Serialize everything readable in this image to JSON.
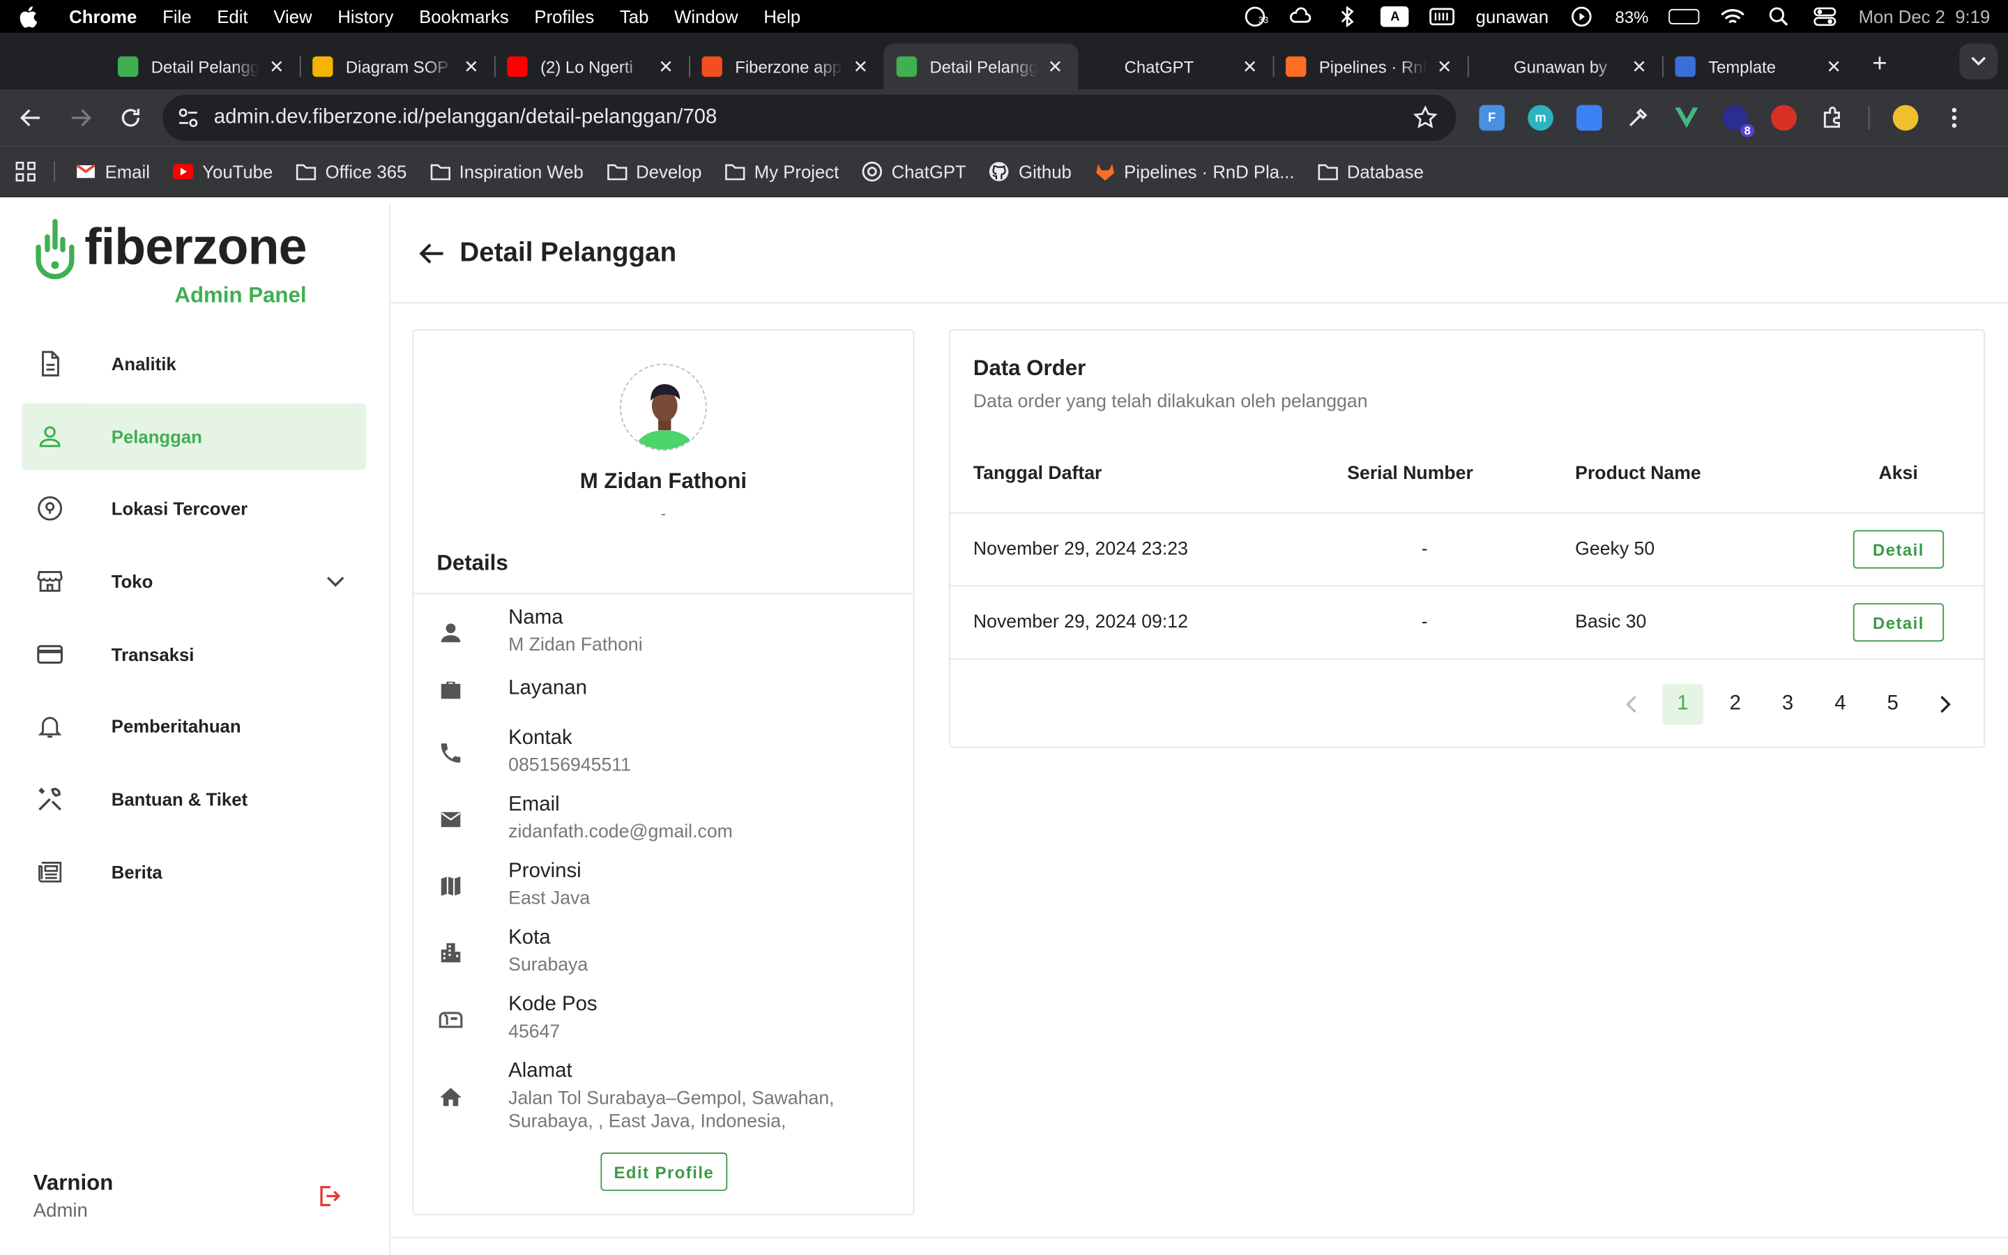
{
  "menubar": {
    "app": "Chrome",
    "items": [
      "File",
      "Edit",
      "View",
      "History",
      "Bookmarks",
      "Profiles",
      "Tab",
      "Window",
      "Help"
    ],
    "notif_count": "33",
    "a_box": "A",
    "username": "gunawan",
    "battery": "83%",
    "battery_level": 0.83,
    "datetime": "Mon Dec 2  9:19"
  },
  "tabs": [
    {
      "title": "Detail Pelanggan",
      "favicon_color": "#3faf51",
      "active": false
    },
    {
      "title": "Diagram SOP",
      "favicon_color": "#f4b400",
      "active": false
    },
    {
      "title": "(2) Lo Ngerti",
      "favicon_color": "#ff0000",
      "active": false
    },
    {
      "title": "Fiberzone app",
      "favicon_color": "#f24e1e",
      "active": false
    },
    {
      "title": "Detail Pelanggan",
      "favicon_color": "#3faf51",
      "active": true
    },
    {
      "title": "ChatGPT",
      "favicon_color": "#202124",
      "active": false
    },
    {
      "title": "Pipelines · RnD",
      "favicon_color": "#fc6d26",
      "active": false
    },
    {
      "title": "Gunawan by",
      "favicon_color": "#202124",
      "active": false
    },
    {
      "title": "Template",
      "favicon_color": "#3b6fd8",
      "active": false
    }
  ],
  "toolbar": {
    "url": "admin.dev.fiberzone.id/pelanggan/detail-pelanggan/708",
    "ext_badge": "8"
  },
  "bookmarks": [
    {
      "label": "Email",
      "icon": "gmail-icon"
    },
    {
      "label": "YouTube",
      "icon": "youtube-icon"
    },
    {
      "label": "Office 365",
      "icon": "folder-icon"
    },
    {
      "label": "Inspiration Web",
      "icon": "folder-icon"
    },
    {
      "label": "Develop",
      "icon": "folder-icon"
    },
    {
      "label": "My Project",
      "icon": "folder-icon"
    },
    {
      "label": "ChatGPT",
      "icon": "chatgpt-icon"
    },
    {
      "label": "Github",
      "icon": "github-icon"
    },
    {
      "label": "Pipelines · RnD Pla...",
      "icon": "gitlab-icon"
    },
    {
      "label": "Database",
      "icon": "folder-icon"
    }
  ],
  "brand": {
    "name": "fiberzone",
    "subtitle": "Admin Panel",
    "accent": "#3faf51"
  },
  "sidebar": {
    "items": [
      {
        "label": "Analitik",
        "icon": "document-icon"
      },
      {
        "label": "Pelanggan",
        "icon": "person-icon",
        "active": true
      },
      {
        "label": "Lokasi Tercover",
        "icon": "location-pin-icon"
      },
      {
        "label": "Toko",
        "icon": "store-icon",
        "expandable": true
      },
      {
        "label": "Transaksi",
        "icon": "credit-card-icon"
      },
      {
        "label": "Pemberitahuan",
        "icon": "bell-icon"
      },
      {
        "label": "Bantuan & Tiket",
        "icon": "tools-icon"
      },
      {
        "label": "Berita",
        "icon": "newspaper-icon"
      }
    ],
    "user": {
      "name": "Varnion",
      "role": "Admin"
    }
  },
  "page": {
    "title": "Detail Pelanggan"
  },
  "profile": {
    "name": "M Zidan Fathoni",
    "subtitle": "-",
    "details_title": "Details",
    "fields": [
      {
        "label": "Nama",
        "value": "M Zidan Fathoni",
        "icon": "person-icon"
      },
      {
        "label": "Layanan",
        "value": "",
        "icon": "briefcase-icon"
      },
      {
        "label": "Kontak",
        "value": "085156945511",
        "icon": "phone-icon"
      },
      {
        "label": "Email",
        "value": "zidanfath.code@gmail.com",
        "icon": "mail-icon"
      },
      {
        "label": "Provinsi",
        "value": "East Java",
        "icon": "map-icon"
      },
      {
        "label": "Kota",
        "value": "Surabaya",
        "icon": "city-icon"
      },
      {
        "label": "Kode Pos",
        "value": "45647",
        "icon": "mailbox-icon"
      },
      {
        "label": "Alamat",
        "value": "Jalan Tol Surabaya–Gempol, Sawahan, Surabaya, , East Java, Indonesia,",
        "icon": "home-icon"
      }
    ],
    "edit_label": "Edit Profile"
  },
  "orders": {
    "title": "Data Order",
    "subtitle": "Data order yang telah dilakukan oleh pelanggan",
    "columns": [
      "Tanggal Daftar",
      "Serial Number",
      "Product Name",
      "Aksi"
    ],
    "rows": [
      {
        "date": "November 29, 2024 23:23",
        "serial": "-",
        "product": "Geeky 50",
        "action": "Detail"
      },
      {
        "date": "November 29, 2024 09:12",
        "serial": "-",
        "product": "Basic 30",
        "action": "Detail"
      }
    ],
    "pages": [
      "1",
      "2",
      "3",
      "4",
      "5"
    ],
    "current_page": "1"
  }
}
